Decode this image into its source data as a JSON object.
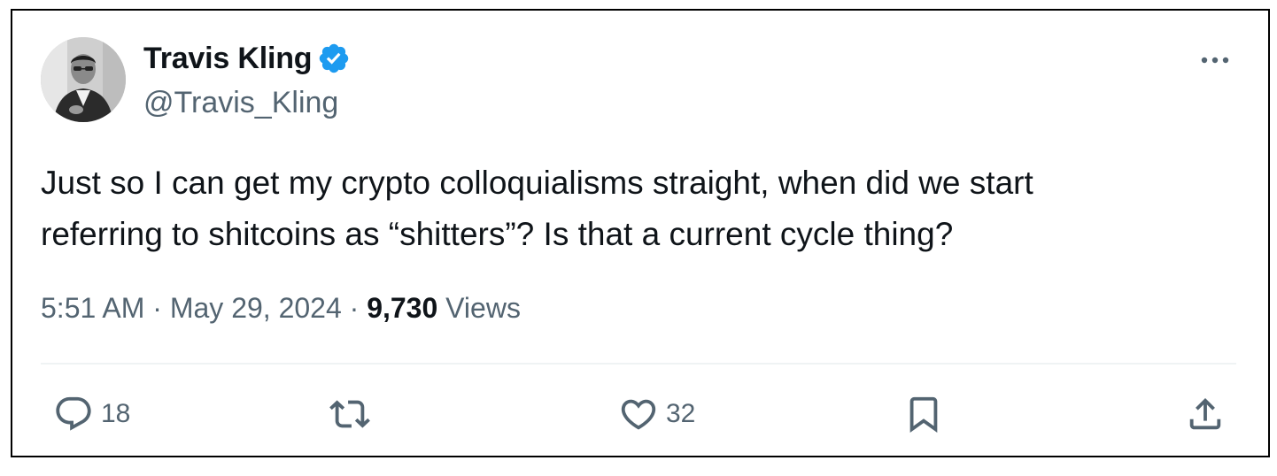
{
  "tweet": {
    "author": {
      "display_name": "Travis Kling",
      "handle": "@Travis_Kling",
      "verified": true,
      "avatar_icon": "profile-photo"
    },
    "more_icon": "ellipsis-icon",
    "text_lines": [
      "Just so I can get my crypto colloquialisms straight, when did we start",
      "referring to shitcoins as “shitters”? Is that a current cycle thing?"
    ],
    "meta": {
      "time": "5:51 AM",
      "separator": " · ",
      "date": "May 29, 2024",
      "views_count": "9,730",
      "views_label": "Views"
    },
    "actions": {
      "reply": {
        "icon": "reply-icon",
        "count": "18"
      },
      "repost": {
        "icon": "repost-icon",
        "count": ""
      },
      "like": {
        "icon": "heart-icon",
        "count": "32"
      },
      "bookmark": {
        "icon": "bookmark-icon"
      },
      "share": {
        "icon": "share-icon"
      }
    }
  },
  "colors": {
    "text_primary": "#0f1419",
    "text_secondary": "#536471",
    "verified_badge": "#1d9bf0",
    "divider": "#eff3f4",
    "card_border": "#000000"
  }
}
